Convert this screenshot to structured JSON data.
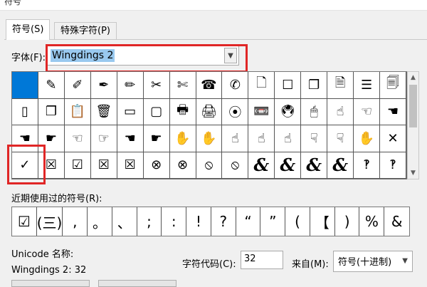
{
  "window": {
    "title": "符号"
  },
  "tabs": [
    {
      "label": "符号(S)"
    },
    {
      "label": "特殊字符(P)"
    }
  ],
  "font": {
    "label": "字体(F):",
    "value": "Wingdings 2"
  },
  "symbol_grid": {
    "rows": [
      [
        "",
        "✎",
        "✐",
        "✒",
        "✏",
        "✂",
        "✄",
        "☎",
        "✆",
        "🗋",
        "☐",
        "❐",
        "🗎",
        "☰",
        "🗐",
        "🗋"
      ],
      [
        "▯",
        "❐",
        "📋",
        "🗑",
        "▭",
        "▢",
        "🖶",
        "🖨",
        "⦿",
        "📼",
        "🖲",
        "🖱",
        "☝",
        "☜",
        "☚",
        "☛"
      ],
      [
        "☚",
        "☛",
        "☜",
        "☞",
        "☚",
        "☛",
        "✋",
        "✋",
        "☝",
        "☝",
        "☝",
        "☟",
        "☟",
        "✋",
        "✕",
        ""
      ],
      [
        "✓",
        "☒",
        "☑",
        "☒",
        "☒",
        "⊗",
        "⊗",
        "⦸",
        "⦸",
        "&",
        "&",
        "&",
        "&",
        "‽",
        "‽",
        "‽"
      ]
    ]
  },
  "recent": {
    "label": "近期使用过的符号(R):",
    "symbols": [
      "☑",
      "(三)",
      ",",
      "。",
      "、",
      ";",
      ":",
      "!",
      "?",
      "“",
      "”",
      "(",
      "【",
      ")",
      "%",
      "&"
    ]
  },
  "unicode": {
    "label": "Unicode 名称:",
    "name": "Wingdings 2: 32"
  },
  "char_code": {
    "label": "字符代码(C):",
    "value": "32"
  },
  "from": {
    "label": "来自(M):",
    "value": "符号(十进制)"
  },
  "colors": {
    "highlight": "#0078d7",
    "annotation": "#e02626",
    "selection_text_bg": "#99c9ef"
  }
}
